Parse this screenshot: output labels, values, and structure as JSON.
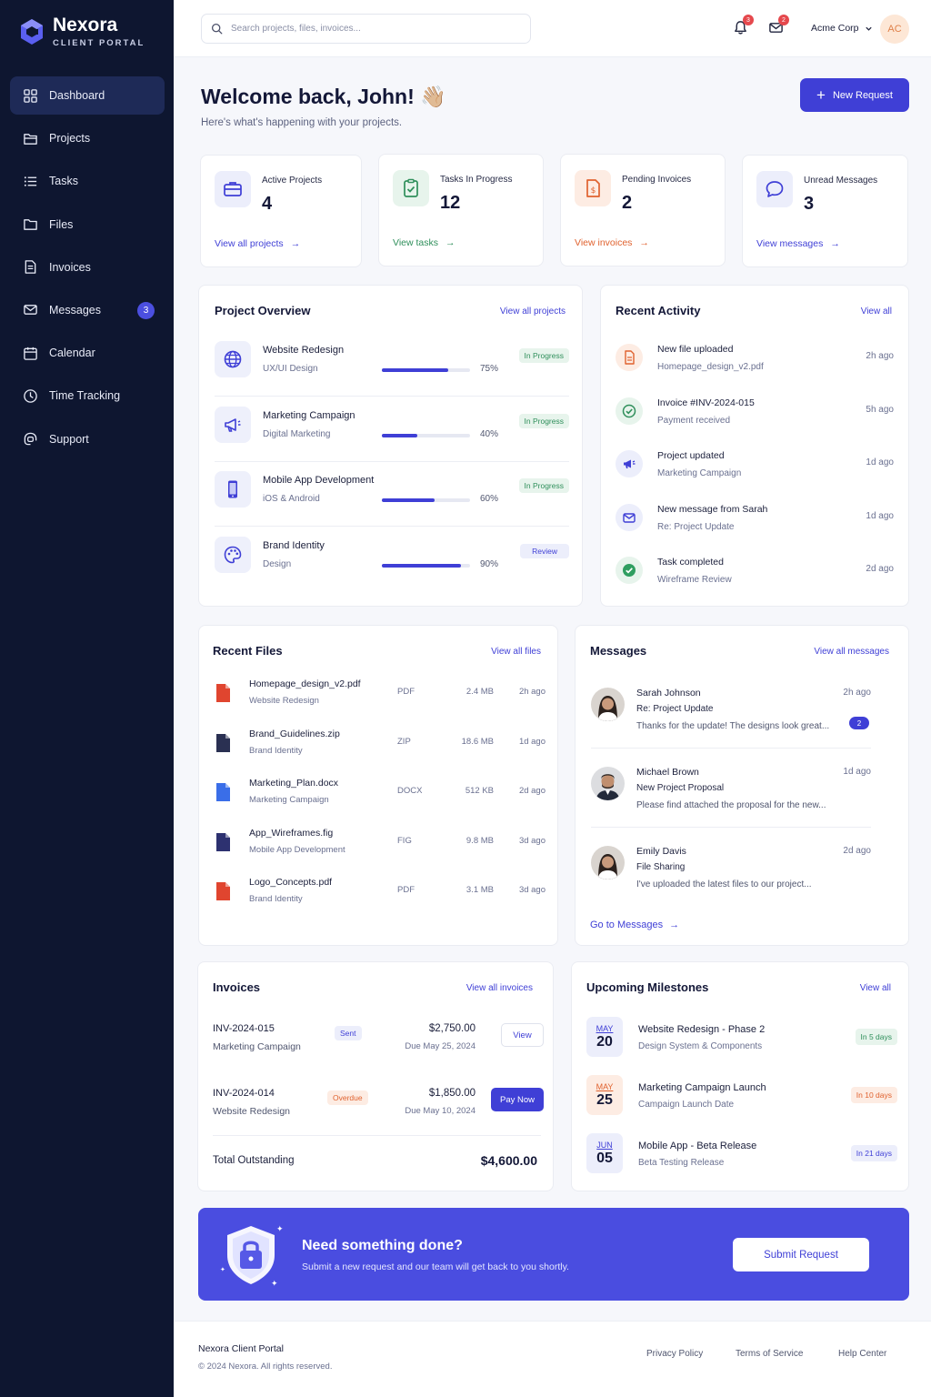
{
  "brand": {
    "name": "Nexora",
    "subtitle": "CLIENT PORTAL"
  },
  "sidebar": {
    "items": [
      {
        "label": "Dashboard",
        "icon": "dashboard-icon",
        "active": true
      },
      {
        "label": "Projects",
        "icon": "folder-icon"
      },
      {
        "label": "Tasks",
        "icon": "list-icon"
      },
      {
        "label": "Files",
        "icon": "file-folder-icon"
      },
      {
        "label": "Invoices",
        "icon": "invoice-icon"
      },
      {
        "label": "Messages",
        "icon": "mail-icon",
        "badge": "3"
      },
      {
        "label": "Calendar",
        "icon": "calendar-icon"
      },
      {
        "label": "Time Tracking",
        "icon": "clock-icon"
      },
      {
        "label": "Support",
        "icon": "support-icon"
      }
    ]
  },
  "topbar": {
    "search_placeholder": "Search projects, files, invoices...",
    "notifications_count": "3",
    "mail_count": "2",
    "company": "Acme Corp",
    "avatar_initials": "AC"
  },
  "header": {
    "welcome": "Welcome back, John! 👋🏼",
    "subtitle": "Here's what's happening with your projects.",
    "new_request": "New Request"
  },
  "stats": [
    {
      "label": "Active Projects",
      "value": "4",
      "link": "View all projects",
      "icon": "briefcase-icon",
      "color": "#3f3fd6",
      "bg": "#eceefb"
    },
    {
      "label": "Tasks In Progress",
      "value": "12",
      "link": "View tasks",
      "icon": "clipboard-check-icon",
      "color": "#2f8f5b",
      "bg": "#e7f4ec"
    },
    {
      "label": "Pending Invoices",
      "value": "2",
      "link": "View invoices",
      "icon": "invoice-dollar-icon",
      "color": "#e0622f",
      "bg": "#fdece3"
    },
    {
      "label": "Unread Messages",
      "value": "3",
      "link": "View messages",
      "icon": "chat-bubble-icon",
      "color": "#3f3fd6",
      "bg": "#eceefb"
    }
  ],
  "project_overview": {
    "title": "Project Overview",
    "link": "View all projects",
    "projects": [
      {
        "name": "Website Redesign",
        "category": "UX/UI Design",
        "progress": 75,
        "progress_label": "75%",
        "status": "In Progress",
        "icon": "globe-icon"
      },
      {
        "name": "Marketing Campaign",
        "category": "Digital Marketing",
        "progress": 40,
        "progress_label": "40%",
        "status": "In Progress",
        "icon": "megaphone-icon"
      },
      {
        "name": "Mobile App Development",
        "category": "iOS & Android",
        "progress": 60,
        "progress_label": "60%",
        "status": "In Progress",
        "icon": "phone-icon"
      },
      {
        "name": "Brand Identity",
        "category": "Design",
        "progress": 90,
        "progress_label": "90%",
        "status": "Review",
        "icon": "palette-icon"
      }
    ]
  },
  "recent_activity": {
    "title": "Recent Activity",
    "link": "View all",
    "items": [
      {
        "title": "New file uploaded",
        "sub": "Homepage_design_v2.pdf",
        "time": "2h ago",
        "icon": "document-icon",
        "color": "#e0622f",
        "bg": "#fdece3"
      },
      {
        "title": "Invoice #INV-2024-015",
        "sub": "Payment received",
        "time": "5h ago",
        "icon": "check-circle-outline-icon",
        "color": "#2f8f5b",
        "bg": "#e7f4ec"
      },
      {
        "title": "Project updated",
        "sub": "Marketing Campaign",
        "time": "1d ago",
        "icon": "megaphone-icon",
        "color": "#3f3fd6",
        "bg": "#eceefb"
      },
      {
        "title": "New message from Sarah",
        "sub": "Re: Project Update",
        "time": "1d ago",
        "icon": "mail-icon",
        "color": "#3f3fd6",
        "bg": "#eceefb"
      },
      {
        "title": "Task completed",
        "sub": "Wireframe Review",
        "time": "2d ago",
        "icon": "check-circle-filled-icon",
        "color": "#2f9e60",
        "bg": "#e7f4ec"
      }
    ]
  },
  "recent_files": {
    "title": "Recent Files",
    "link": "View all files",
    "files": [
      {
        "name": "Homepage_design_v2.pdf",
        "project": "Website Redesign",
        "type": "PDF",
        "size": "2.4 MB",
        "date": "2h ago",
        "icon": "pdf-file-icon",
        "color": "#e0452f"
      },
      {
        "name": "Brand_Guidelines.zip",
        "project": "Brand Identity",
        "type": "ZIP",
        "size": "18.6 MB",
        "date": "1d ago",
        "icon": "zip-file-icon",
        "color": "#2a3052"
      },
      {
        "name": "Marketing_Plan.docx",
        "project": "Marketing Campaign",
        "type": "DOCX",
        "size": "512 KB",
        "date": "2d ago",
        "icon": "docx-file-icon",
        "color": "#3a6ee8"
      },
      {
        "name": "App_Wireframes.fig",
        "project": "Mobile App Development",
        "type": "FIG",
        "size": "9.8 MB",
        "date": "3d ago",
        "icon": "fig-file-icon",
        "color": "#2d3170"
      },
      {
        "name": "Logo_Concepts.pdf",
        "project": "Brand Identity",
        "type": "PDF",
        "size": "3.1 MB",
        "date": "3d ago",
        "icon": "pdf-file-icon",
        "color": "#e0452f"
      }
    ]
  },
  "messages": {
    "title": "Messages",
    "link": "View all messages",
    "go_link": "Go to Messages",
    "items": [
      {
        "name": "Sarah Johnson",
        "subject": "Re: Project Update",
        "preview": "Thanks for the update! The designs look great...",
        "time": "2h ago",
        "badge": "2",
        "avatar": "woman-avatar"
      },
      {
        "name": "Michael Brown",
        "subject": "New Project Proposal",
        "preview": "Please find attached the proposal for the new...",
        "time": "1d ago",
        "avatar": "man-avatar"
      },
      {
        "name": "Emily Davis",
        "subject": "File Sharing",
        "preview": "I've uploaded the latest files to our project...",
        "time": "2d ago",
        "avatar": "woman-avatar"
      }
    ]
  },
  "invoices": {
    "title": "Invoices",
    "link": "View all invoices",
    "items": [
      {
        "number": "INV-2024-015",
        "project": "Marketing Campaign",
        "status": "Sent",
        "amount": "$2,750.00",
        "due": "Due May 25, 2024",
        "action": "View"
      },
      {
        "number": "INV-2024-014",
        "project": "Website Redesign",
        "status": "Overdue",
        "amount": "$1,850.00",
        "due": "Due May 10, 2024",
        "action": "Pay Now"
      }
    ],
    "total_label": "Total Outstanding",
    "total_value": "$4,600.00"
  },
  "milestones": {
    "title": "Upcoming Milestones",
    "link": "View all",
    "items": [
      {
        "month": "MAY",
        "day": "20",
        "title": "Website Redesign - Phase 2",
        "sub": "Design System & Components",
        "badge": "In 5 days",
        "color": "#2f8f5b",
        "bg": "#e7f4ec",
        "date_bg": "#eceefb",
        "month_color": "#3f3fd6"
      },
      {
        "month": "MAY",
        "day": "25",
        "title": "Marketing Campaign Launch",
        "sub": "Campaign Launch Date",
        "badge": "In 10 days",
        "color": "#e0622f",
        "bg": "#fdece3",
        "date_bg": "#fdece3",
        "month_color": "#e0622f"
      },
      {
        "month": "JUN",
        "day": "05",
        "title": "Mobile App - Beta Release",
        "sub": "Beta Testing Release",
        "badge": "In 21 days",
        "color": "#3f3fd6",
        "bg": "#eceefb",
        "date_bg": "#eceefb",
        "month_color": "#3f3fd6"
      }
    ]
  },
  "cta": {
    "title": "Need something done?",
    "subtitle": "Submit a new request and our team will get back to you shortly.",
    "button": "Submit Request"
  },
  "footer": {
    "brand": "Nexora Client Portal",
    "copyright": "© 2024 Nexora. All rights reserved.",
    "links": [
      "Privacy Policy",
      "Terms of Service",
      "Help Center"
    ]
  },
  "colors": {
    "accent": "#3f3fd6",
    "sidebar": "#0e1630",
    "in_progress_bg": "#e7f4ec",
    "in_progress_fg": "#2f8f5b",
    "review_bg": "#eceefb",
    "review_fg": "#3f3fd6"
  }
}
